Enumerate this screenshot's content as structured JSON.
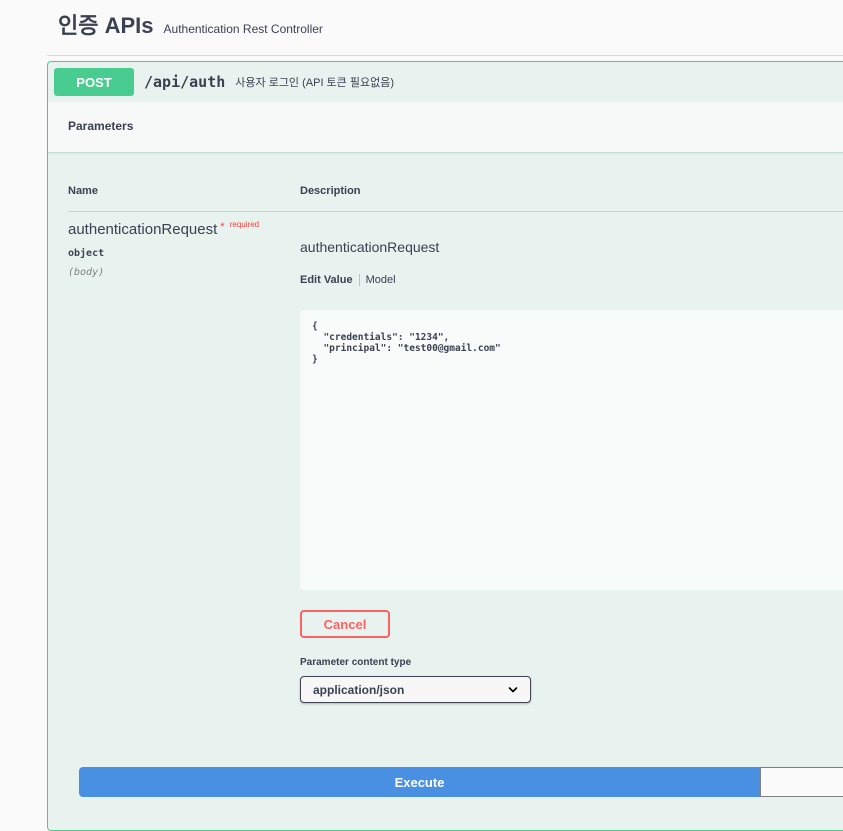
{
  "tag": {
    "title": "인증 APIs",
    "description": "Authentication Rest Controller"
  },
  "operation": {
    "method": "POST",
    "path": "/api/auth",
    "summary": "사용자 로그인 (API 토큰 필요없음)"
  },
  "parameters": {
    "section_title": "Parameters",
    "columns": {
      "name": "Name",
      "description": "Description"
    },
    "items": [
      {
        "name": "authenticationRequest",
        "required_star": "*",
        "required_label": "required",
        "type": "object",
        "in": "(body)",
        "description": "authenticationRequest",
        "tabs": {
          "edit": "Edit Value",
          "model": "Model"
        },
        "body_value": "{\n  \"credentials\": \"1234\",\n  \"principal\": \"test00@gmail.com\"\n}"
      }
    ]
  },
  "cancel_label": "Cancel",
  "content_type": {
    "label": "Parameter content type",
    "selected": "application/json"
  },
  "execute_label": "Execute",
  "colors": {
    "post": "#49cc90",
    "execute": "#4990e2",
    "cancel": "#ff6060"
  }
}
